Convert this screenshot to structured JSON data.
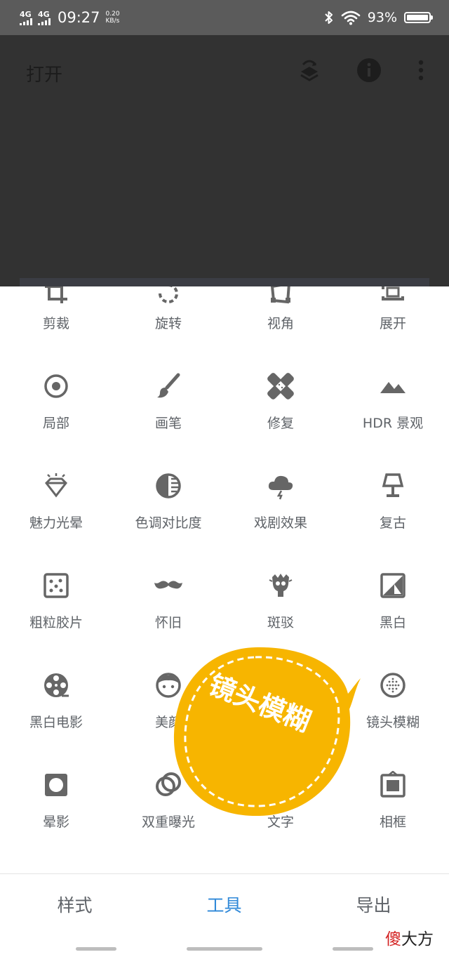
{
  "status_bar": {
    "network_1": "4G",
    "network_2": "4G",
    "time": "09:27",
    "speed_value": "0.20",
    "speed_unit": "KB/s",
    "battery_percent": "93%",
    "icons": [
      "signal-icon",
      "signal-icon",
      "bluetooth-icon",
      "wifi-icon",
      "battery-icon"
    ]
  },
  "header": {
    "title": "打开",
    "icons": [
      "layers-undo-icon",
      "info-icon",
      "more-vert-icon"
    ]
  },
  "tools": [
    {
      "label": "剪裁",
      "icon": "crop-icon"
    },
    {
      "label": "旋转",
      "icon": "rotate-icon"
    },
    {
      "label": "视角",
      "icon": "perspective-icon"
    },
    {
      "label": "展开",
      "icon": "expand-icon"
    },
    {
      "label": "局部",
      "icon": "selective-icon"
    },
    {
      "label": "画笔",
      "icon": "brush-icon"
    },
    {
      "label": "修复",
      "icon": "healing-icon"
    },
    {
      "label": "HDR 景观",
      "icon": "hdr-landscape-icon"
    },
    {
      "label": "魅力光晕",
      "icon": "glamour-glow-icon"
    },
    {
      "label": "色调对比度",
      "icon": "tonal-contrast-icon"
    },
    {
      "label": "戏剧效果",
      "icon": "drama-icon"
    },
    {
      "label": "复古",
      "icon": "vintage-lamp-icon"
    },
    {
      "label": "粗粒胶片",
      "icon": "grainy-film-icon"
    },
    {
      "label": "怀旧",
      "icon": "mustache-icon"
    },
    {
      "label": "斑驳",
      "icon": "grunge-icon"
    },
    {
      "label": "黑白",
      "icon": "black-white-icon"
    },
    {
      "label": "黑白电影",
      "icon": "film-reel-icon"
    },
    {
      "label": "美颜",
      "icon": "face-icon"
    },
    {
      "label": "",
      "icon": "hidden-tool-icon"
    },
    {
      "label": "镜头模糊",
      "icon": "lens-blur-icon"
    },
    {
      "label": "晕影",
      "icon": "vignette-icon"
    },
    {
      "label": "双重曝光",
      "icon": "double-exposure-icon"
    },
    {
      "label": "文字",
      "icon": "text-icon"
    },
    {
      "label": "相框",
      "icon": "frame-icon"
    }
  ],
  "sticker": {
    "text": "镜头模糊",
    "color": "#f7b500"
  },
  "bottom_nav": {
    "tabs": [
      {
        "label": "样式",
        "active": false
      },
      {
        "label": "工具",
        "active": true
      },
      {
        "label": "导出",
        "active": false
      }
    ],
    "accent": "#2f88d8"
  },
  "watermark": {
    "part1": "傻",
    "part2": "大方"
  }
}
